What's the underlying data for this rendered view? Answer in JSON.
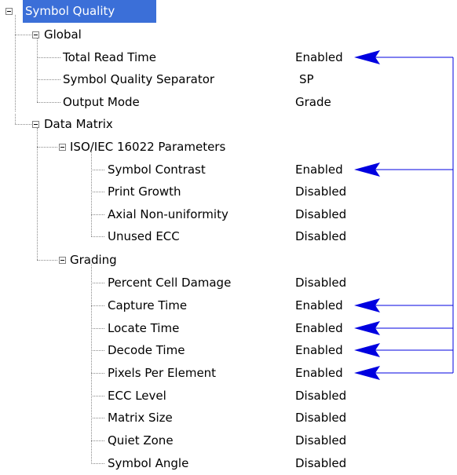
{
  "tree": {
    "root": {
      "label": "Symbol Quality",
      "expanded": true,
      "children": {
        "global": {
          "label": "Global",
          "expanded": true,
          "items": [
            {
              "label": "Total Read Time",
              "value": "Enabled",
              "arrow": true
            },
            {
              "label": "Symbol Quality Separator",
              "value": "SP",
              "arrow": false
            },
            {
              "label": "Output Mode",
              "value": "Grade",
              "arrow": false
            }
          ]
        },
        "data_matrix": {
          "label": "Data Matrix",
          "expanded": true,
          "iso": {
            "label": "ISO/IEC 16022 Parameters",
            "expanded": true,
            "items": [
              {
                "label": "Symbol Contrast",
                "value": "Enabled",
                "arrow": true
              },
              {
                "label": "Print Growth",
                "value": "Disabled",
                "arrow": false
              },
              {
                "label": "Axial Non-uniformity",
                "value": "Disabled",
                "arrow": false
              },
              {
                "label": "Unused ECC",
                "value": "Disabled",
                "arrow": false
              }
            ]
          },
          "grading": {
            "label": "Grading",
            "expanded": true,
            "items": [
              {
                "label": "Percent Cell Damage",
                "value": "Disabled",
                "arrow": false
              },
              {
                "label": "Capture Time",
                "value": "Enabled",
                "arrow": true
              },
              {
                "label": "Locate Time",
                "value": "Enabled",
                "arrow": true
              },
              {
                "label": "Decode Time",
                "value": "Enabled",
                "arrow": true
              },
              {
                "label": "Pixels Per Element",
                "value": "Enabled",
                "arrow": true
              },
              {
                "label": "ECC Level",
                "value": "Disabled",
                "arrow": false
              },
              {
                "label": "Matrix Size",
                "value": "Disabled",
                "arrow": false
              },
              {
                "label": "Quiet Zone",
                "value": "Disabled",
                "arrow": false
              },
              {
                "label": "Symbol Angle",
                "value": "Disabled",
                "arrow": false
              }
            ]
          }
        }
      }
    }
  },
  "colors": {
    "selection": "#3b6fd8",
    "arrow": "#0000e0",
    "tree_lines": "#8a8a8a"
  }
}
